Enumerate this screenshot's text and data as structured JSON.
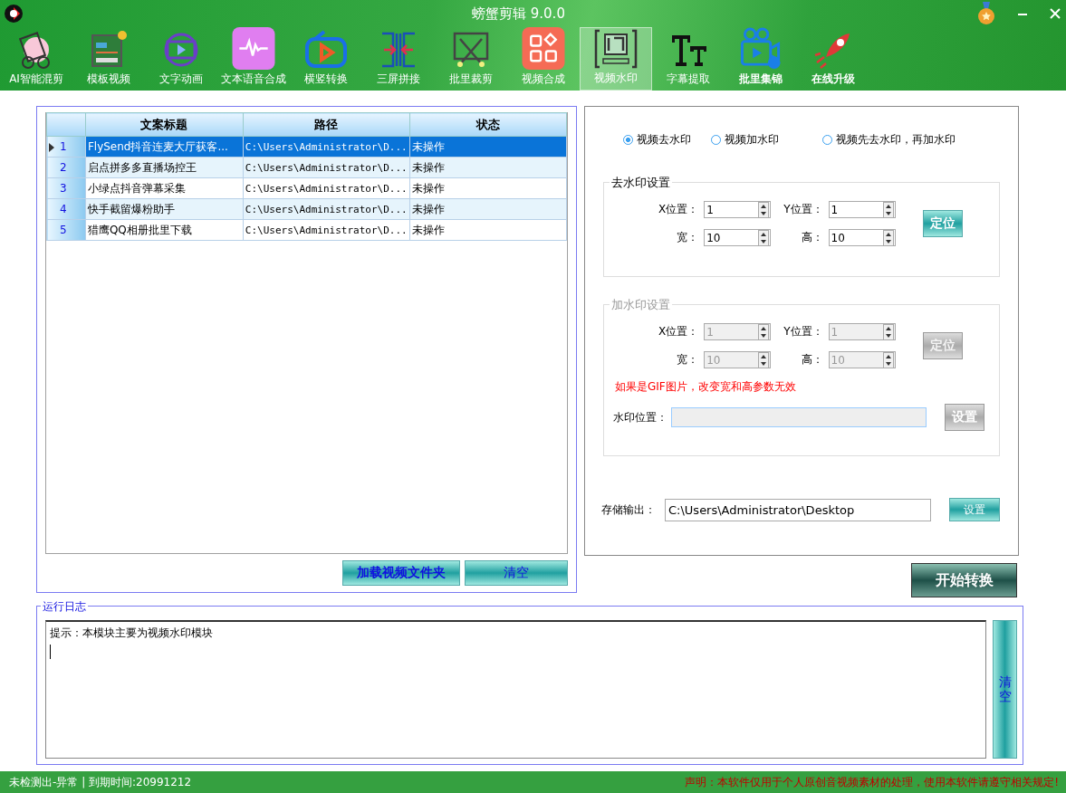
{
  "window": {
    "title": "螃蟹剪辑 9.0.0"
  },
  "toolbar": [
    {
      "label": "AI智能混剪",
      "selected": false,
      "bold": false
    },
    {
      "label": "模板视频",
      "selected": false,
      "bold": false
    },
    {
      "label": "文字动画",
      "selected": false,
      "bold": false
    },
    {
      "label": "文本语音合成",
      "selected": false,
      "bold": false
    },
    {
      "label": "横竖转换",
      "selected": false,
      "bold": false
    },
    {
      "label": "三屏拼接",
      "selected": false,
      "bold": false
    },
    {
      "label": "批里裁剪",
      "selected": false,
      "bold": false
    },
    {
      "label": "视频合成",
      "selected": false,
      "bold": false
    },
    {
      "label": "视频水印",
      "selected": true,
      "bold": false
    },
    {
      "label": "字幕提取",
      "selected": false,
      "bold": false
    },
    {
      "label": "批里集锦",
      "selected": false,
      "bold": true
    },
    {
      "label": "在线升级",
      "selected": false,
      "bold": true
    }
  ],
  "table": {
    "columns": [
      "文案标题",
      "路径",
      "状态"
    ],
    "rows": [
      {
        "number": "1",
        "title": "FlySend抖音连麦大厅获客...",
        "path": "C:\\Users\\Administrator\\D...",
        "status": "未操作",
        "selected": true
      },
      {
        "number": "2",
        "title": "启点拼多多直播场控王",
        "path": "C:\\Users\\Administrator\\D...",
        "status": "未操作",
        "selected": false
      },
      {
        "number": "3",
        "title": "小绿点抖音弹幕采集",
        "path": "C:\\Users\\Administrator\\D...",
        "status": "未操作",
        "selected": false
      },
      {
        "number": "4",
        "title": "快手截留爆粉助手",
        "path": "C:\\Users\\Administrator\\D...",
        "status": "未操作",
        "selected": false
      },
      {
        "number": "5",
        "title": "猎鹰QQ相册批里下载",
        "path": "C:\\Users\\Administrator\\D...",
        "status": "未操作",
        "selected": false
      }
    ]
  },
  "list_buttons": [
    "加载视频文件夹",
    "清空"
  ],
  "modes": [
    {
      "label": "视频去水印",
      "selected": true
    },
    {
      "label": "视频加水印",
      "selected": false
    },
    {
      "label": "视频先去水印，再加水印",
      "selected": false
    }
  ],
  "remove_settings": {
    "title": "去水印设置",
    "disabled": false,
    "fields": [
      {
        "label": "X位置：",
        "value": "1"
      },
      {
        "label": "Y位置：",
        "value": "1"
      },
      {
        "label": "宽：",
        "value": "10"
      },
      {
        "label": "高：",
        "value": "10"
      }
    ],
    "button": "定位"
  },
  "add_settings": {
    "title": "加水印设置",
    "disabled": true,
    "fields": [
      {
        "label": "X位置：",
        "value": "1"
      },
      {
        "label": "Y位置：",
        "value": "1"
      },
      {
        "label": "宽：",
        "value": "10"
      },
      {
        "label": "高：",
        "value": "10"
      }
    ],
    "button": "定位",
    "note": "如果是GIF图片，改变宽和高参数无效",
    "position_label": "水印位置：",
    "position_button": "设置"
  },
  "output": {
    "label": "存储输出：",
    "value": "C:\\Users\\Administrator\\Desktop",
    "button": "设置"
  },
  "start_button": "开始转换",
  "log": {
    "title": "运行日志",
    "text": "提示：本模块主要为视频水印模块",
    "clear_button": "清空"
  },
  "status_bar": {
    "left": "未检测出-异常 | 到期时间:20991212",
    "right": "声明：本软件仅用于个人原创音视频素材的处理，使用本软件请遵守相关规定!"
  }
}
